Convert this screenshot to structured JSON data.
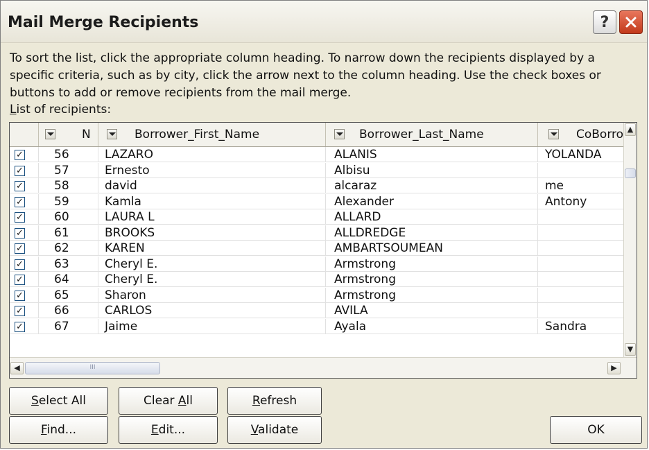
{
  "dialog": {
    "title": "Mail Merge Recipients",
    "help_symbol": "?",
    "close_symbol": "✕",
    "instructions": "To sort the list, click the appropriate column heading.  To narrow down the recipients displayed by a specific criteria, such as by city, click the arrow next to the column heading.  Use the check boxes or buttons to add or remove recipients from the mail merge.",
    "list_label": {
      "mnemonic": "L",
      "rest": "ist of recipients:"
    }
  },
  "table": {
    "columns": [
      "N",
      "Borrower_First_Name",
      "Borrower_Last_Name",
      "CoBorrow"
    ],
    "check_mark": "✓",
    "rows": [
      {
        "checked": true,
        "n": "56",
        "first": "LAZARO",
        "last": "ALANIS",
        "co": "YOLANDA"
      },
      {
        "checked": true,
        "n": "57",
        "first": "Ernesto",
        "last": "Albisu",
        "co": ""
      },
      {
        "checked": true,
        "n": "58",
        "first": "david",
        "last": "alcaraz",
        "co": "me"
      },
      {
        "checked": true,
        "n": "59",
        "first": "Kamla",
        "last": "Alexander",
        "co": "Antony"
      },
      {
        "checked": true,
        "n": "60",
        "first": "LAURA L",
        "last": "ALLARD",
        "co": ""
      },
      {
        "checked": true,
        "n": "61",
        "first": "BROOKS",
        "last": "ALLDREDGE",
        "co": ""
      },
      {
        "checked": true,
        "n": "62",
        "first": "KAREN",
        "last": "AMBARTSOUMEAN",
        "co": ""
      },
      {
        "checked": true,
        "n": "63",
        "first": "Cheryl E.",
        "last": "Armstrong",
        "co": ""
      },
      {
        "checked": true,
        "n": "64",
        "first": "Cheryl E.",
        "last": "Armstrong",
        "co": ""
      },
      {
        "checked": true,
        "n": "65",
        "first": "Sharon",
        "last": "Armstrong",
        "co": ""
      },
      {
        "checked": true,
        "n": "66",
        "first": "CARLOS",
        "last": "AVILA",
        "co": ""
      },
      {
        "checked": true,
        "n": "67",
        "first": "Jaime",
        "last": "Ayala",
        "co": "Sandra"
      }
    ],
    "scroll": {
      "up": "▲",
      "down": "▼",
      "left": "◀",
      "right": "▶",
      "grip": "III"
    }
  },
  "buttons": {
    "select_all": {
      "mnemonic": "S",
      "rest": "elect All"
    },
    "clear_all": {
      "pre": "Clear ",
      "mnemonic": "A",
      "rest": "ll"
    },
    "refresh": {
      "mnemonic": "R",
      "rest": "efresh"
    },
    "find": {
      "mnemonic": "F",
      "rest": "ind..."
    },
    "edit": {
      "mnemonic": "E",
      "rest": "dit..."
    },
    "validate": {
      "mnemonic": "V",
      "rest": "alidate"
    },
    "ok": "OK"
  },
  "colors": {
    "dialog_bg": "#ece9d8",
    "close_button": "#c2391b",
    "checkbox_border": "#1c5180"
  }
}
